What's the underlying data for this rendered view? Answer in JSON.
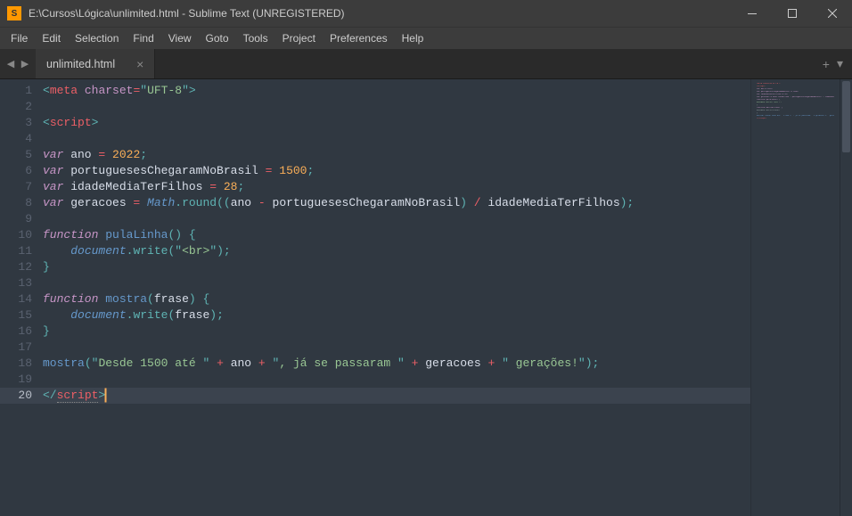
{
  "window": {
    "title": "E:\\Cursos\\Lógica\\unlimited.html - Sublime Text (UNREGISTERED)"
  },
  "menu": [
    "File",
    "Edit",
    "Selection",
    "Find",
    "View",
    "Goto",
    "Tools",
    "Project",
    "Preferences",
    "Help"
  ],
  "tab": {
    "label": "unlimited.html"
  },
  "code": {
    "lines": [
      {
        "n": 1,
        "tokens": [
          [
            "p",
            "<"
          ],
          [
            "tag",
            "meta"
          ],
          [
            "id",
            " "
          ],
          [
            "attr",
            "charset"
          ],
          [
            "op",
            "="
          ],
          [
            "p",
            "\""
          ],
          [
            "str-n",
            "UFT-8"
          ],
          [
            "p",
            "\""
          ],
          [
            "p",
            ">"
          ]
        ]
      },
      {
        "n": 2,
        "tokens": []
      },
      {
        "n": 3,
        "tokens": [
          [
            "p",
            "<"
          ],
          [
            "tag",
            "script"
          ],
          [
            "p",
            ">"
          ]
        ]
      },
      {
        "n": 4,
        "tokens": []
      },
      {
        "n": 5,
        "tokens": [
          [
            "kw",
            "var"
          ],
          [
            "id",
            " ano "
          ],
          [
            "op",
            "="
          ],
          [
            "id",
            " "
          ],
          [
            "num",
            "2022"
          ],
          [
            "p",
            ";"
          ]
        ]
      },
      {
        "n": 6,
        "tokens": [
          [
            "kw",
            "var"
          ],
          [
            "id",
            " portuguesesChegaramNoBrasil "
          ],
          [
            "op",
            "="
          ],
          [
            "id",
            " "
          ],
          [
            "num",
            "1500"
          ],
          [
            "p",
            ";"
          ]
        ]
      },
      {
        "n": 7,
        "tokens": [
          [
            "kw",
            "var"
          ],
          [
            "id",
            " idadeMediaTerFilhos "
          ],
          [
            "op",
            "="
          ],
          [
            "id",
            " "
          ],
          [
            "num",
            "28"
          ],
          [
            "p",
            ";"
          ]
        ]
      },
      {
        "n": 8,
        "tokens": [
          [
            "kw",
            "var"
          ],
          [
            "id",
            " geracoes "
          ],
          [
            "op",
            "="
          ],
          [
            "id",
            " "
          ],
          [
            "obj",
            "Math"
          ],
          [
            "p",
            "."
          ],
          [
            "call",
            "round"
          ],
          [
            "p",
            "(("
          ],
          [
            "id",
            "ano "
          ],
          [
            "op",
            "-"
          ],
          [
            "id",
            " portuguesesChegaramNoBrasil"
          ],
          [
            "p",
            ") "
          ],
          [
            "op",
            "/"
          ],
          [
            "id",
            " idadeMediaTerFilhos"
          ],
          [
            "p",
            ");"
          ]
        ]
      },
      {
        "n": 9,
        "tokens": []
      },
      {
        "n": 10,
        "tokens": [
          [
            "kw",
            "function"
          ],
          [
            "id",
            " "
          ],
          [
            "fn",
            "pulaLinha"
          ],
          [
            "p",
            "() {"
          ]
        ]
      },
      {
        "n": 11,
        "indent": 1,
        "tokens": [
          [
            "obj",
            "document"
          ],
          [
            "p",
            "."
          ],
          [
            "call",
            "write"
          ],
          [
            "p",
            "("
          ],
          [
            "p",
            "\""
          ],
          [
            "str-n",
            "<br>"
          ],
          [
            "p",
            "\""
          ],
          [
            "p",
            ");"
          ]
        ]
      },
      {
        "n": 12,
        "tokens": [
          [
            "p",
            "}"
          ]
        ]
      },
      {
        "n": 13,
        "tokens": []
      },
      {
        "n": 14,
        "tokens": [
          [
            "kw",
            "function"
          ],
          [
            "id",
            " "
          ],
          [
            "fn",
            "mostra"
          ],
          [
            "p",
            "("
          ],
          [
            "id",
            "frase"
          ],
          [
            "p",
            ") {"
          ]
        ]
      },
      {
        "n": 15,
        "indent": 1,
        "tokens": [
          [
            "obj",
            "document"
          ],
          [
            "p",
            "."
          ],
          [
            "call",
            "write"
          ],
          [
            "p",
            "("
          ],
          [
            "id",
            "frase"
          ],
          [
            "p",
            ");"
          ]
        ]
      },
      {
        "n": 16,
        "tokens": [
          [
            "p",
            "}"
          ]
        ]
      },
      {
        "n": 17,
        "tokens": []
      },
      {
        "n": 18,
        "tokens": [
          [
            "fn",
            "mostra"
          ],
          [
            "p",
            "("
          ],
          [
            "p",
            "\""
          ],
          [
            "str-n",
            "Desde 1500 até "
          ],
          [
            "p",
            "\""
          ],
          [
            "id",
            " "
          ],
          [
            "op",
            "+"
          ],
          [
            "id",
            " ano "
          ],
          [
            "op",
            "+"
          ],
          [
            "id",
            " "
          ],
          [
            "p",
            "\""
          ],
          [
            "str-n",
            ", já se passaram "
          ],
          [
            "p",
            "\""
          ],
          [
            "id",
            " "
          ],
          [
            "op",
            "+"
          ],
          [
            "id",
            " geracoes "
          ],
          [
            "op",
            "+"
          ],
          [
            "id",
            " "
          ],
          [
            "p",
            "\""
          ],
          [
            "str-n",
            " gerações!"
          ],
          [
            "p",
            "\""
          ],
          [
            "p",
            ");"
          ]
        ]
      },
      {
        "n": 19,
        "tokens": []
      },
      {
        "n": 20,
        "active": true,
        "tokens": [
          [
            "p",
            "</"
          ],
          [
            "tag",
            "script",
            "underline-dots"
          ],
          [
            "p",
            ">"
          ],
          [
            "cursor",
            ""
          ]
        ]
      }
    ]
  }
}
